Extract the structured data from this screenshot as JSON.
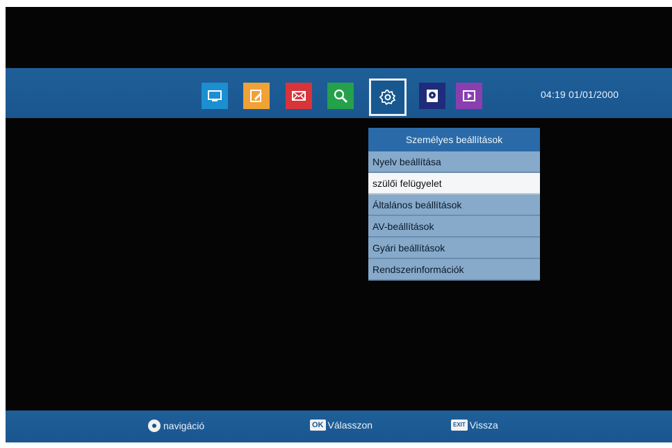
{
  "header": {
    "clock": "04:19 01/01/2000",
    "icons": [
      {
        "name": "tv-icon",
        "color": "#1b8fd0"
      },
      {
        "name": "edit-icon",
        "color": "#f0a236"
      },
      {
        "name": "mail-icon",
        "color": "#d8343a"
      },
      {
        "name": "search-icon",
        "color": "#24a14a"
      },
      {
        "name": "settings-icon",
        "color": "#16588f",
        "selected": true
      },
      {
        "name": "storage-icon",
        "color": "#1e2c7a"
      },
      {
        "name": "media-play-icon",
        "color": "#8a3fb0"
      }
    ]
  },
  "menu": {
    "title": "Személyes beállítások",
    "items": [
      "Nyelv beállítása",
      "szülői felügyelet",
      "Általános beállítások",
      "AV-beállítások",
      "Gyári beállítások",
      "Rendszerinformációk"
    ],
    "selected_index": 1
  },
  "footer": {
    "nav_label": "navigáció",
    "ok_key": "OK",
    "ok_label": "Válasszon",
    "exit_key": "EXIT",
    "exit_label": "Vissza"
  }
}
